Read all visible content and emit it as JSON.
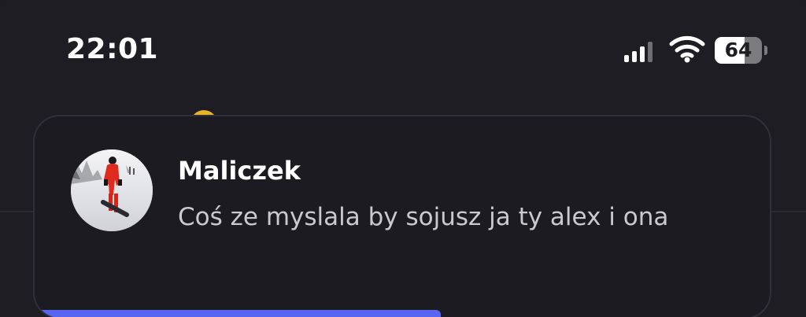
{
  "status_bar": {
    "time": "22:01",
    "battery_level": "64",
    "battery_fraction": 0.64,
    "signal_bars_active": 3,
    "signal_bars_total": 4,
    "icons": [
      "cellular-signal-icon",
      "wifi-icon",
      "battery-icon"
    ]
  },
  "notification": {
    "sender": "Maliczek",
    "message": "Coś ze myslala by sojusz ja ty alex i ona",
    "progress_fraction": 0.55,
    "accent_color": "#5865f2"
  }
}
